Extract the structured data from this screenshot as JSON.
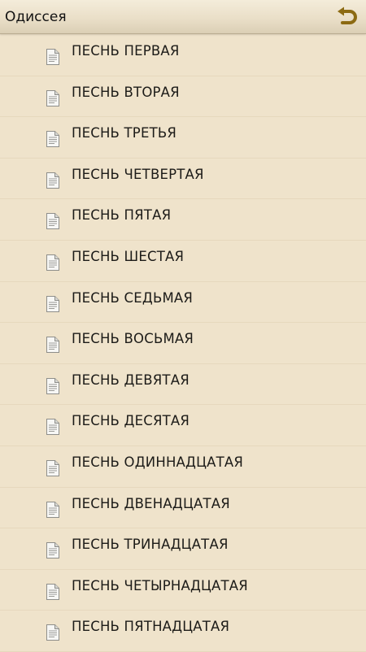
{
  "header": {
    "title": "Одиссея",
    "back_icon": "undo-arrow-icon",
    "accent_color": "#8c6a12"
  },
  "colors": {
    "background": "#efe3cb",
    "divider": "#e6d8bd"
  },
  "list": {
    "item_icon": "document-icon",
    "items": [
      {
        "label": "ПЕСНЬ ПЕРВАЯ"
      },
      {
        "label": "ПЕСНЬ ВТОРАЯ"
      },
      {
        "label": "ПЕСНЬ ТРЕТЬЯ"
      },
      {
        "label": "ПЕСНЬ ЧЕТВЕРТАЯ"
      },
      {
        "label": "ПЕСНЬ ПЯТАЯ"
      },
      {
        "label": "ПЕСНЬ ШЕСТАЯ"
      },
      {
        "label": "ПЕСНЬ СЕДЬМАЯ"
      },
      {
        "label": "ПЕСНЬ ВОСЬМАЯ"
      },
      {
        "label": "ПЕСНЬ ДЕВЯТАЯ"
      },
      {
        "label": "ПЕСНЬ ДЕСЯТАЯ"
      },
      {
        "label": "ПЕСНЬ ОДИННАДЦАТАЯ"
      },
      {
        "label": "ПЕСНЬ ДВЕНАДЦАТАЯ"
      },
      {
        "label": "ПЕСНЬ ТРИНАДЦАТАЯ"
      },
      {
        "label": "ПЕСНЬ ЧЕТЫРНАДЦАТАЯ"
      },
      {
        "label": "ПЕСНЬ ПЯТНАДЦАТАЯ"
      }
    ]
  }
}
